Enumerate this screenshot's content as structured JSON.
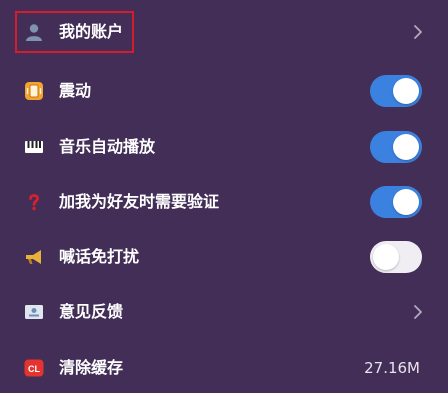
{
  "settings": {
    "account": {
      "label": "我的账户",
      "icon": "user-icon"
    },
    "vibrate": {
      "label": "震动",
      "icon": "vibration-icon",
      "enabled": true
    },
    "music_autoplay": {
      "label": "音乐自动播放",
      "icon": "piano-icon",
      "enabled": true
    },
    "friend_verify": {
      "label": "加我为好友时需要验证",
      "icon": "question-icon",
      "enabled": true
    },
    "shout_no_disturb": {
      "label": "喊话免打扰",
      "icon": "horn-icon",
      "enabled": false
    },
    "feedback": {
      "label": "意见反馈",
      "icon": "feedback-card-icon"
    },
    "clear_cache": {
      "label": "清除缓存",
      "icon": "cl-badge-icon",
      "icon_text": "CL",
      "value": "27.16M"
    }
  },
  "colors": {
    "background": "#422e56",
    "toggle_on": "#3b82e0",
    "toggle_off": "#f0eef2",
    "highlight": "#d61c2a"
  }
}
